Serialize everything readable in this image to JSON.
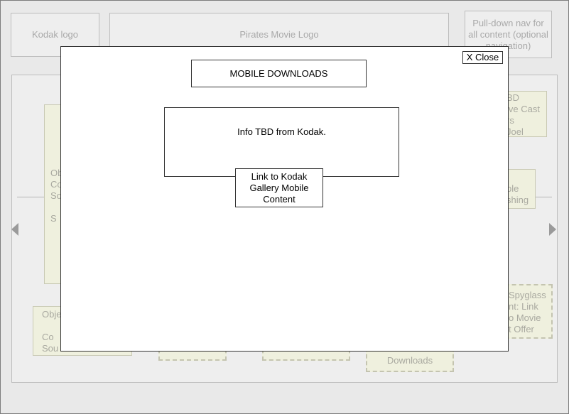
{
  "background": {
    "header": {
      "kodak_logo": "Kodak logo",
      "pirates_logo": "Pirates Movie Logo",
      "pulldown_nav": "Pull-down nav for all content (optional navigation)"
    },
    "panels": {
      "left_tall_fragment": "Obj\nCo\nSo\n\nS",
      "left_bottom_fragment": "Obje\n\nCo\nSou",
      "right_top_fragment": "BD\nive Cast\nrs\nJoel",
      "right_mid_fragment": "ble\nshing",
      "right_bottom_fragment": "Spyglass\nnt: Link\no Movie\nt Offer",
      "bottom_center_fragment": "Downloads"
    }
  },
  "modal": {
    "close_label": "X Close",
    "title": "MOBILE DOWNLOADS",
    "info_text": "Info TBD from Kodak.",
    "link_label": "Link to Kodak Gallery Mobile Content"
  }
}
